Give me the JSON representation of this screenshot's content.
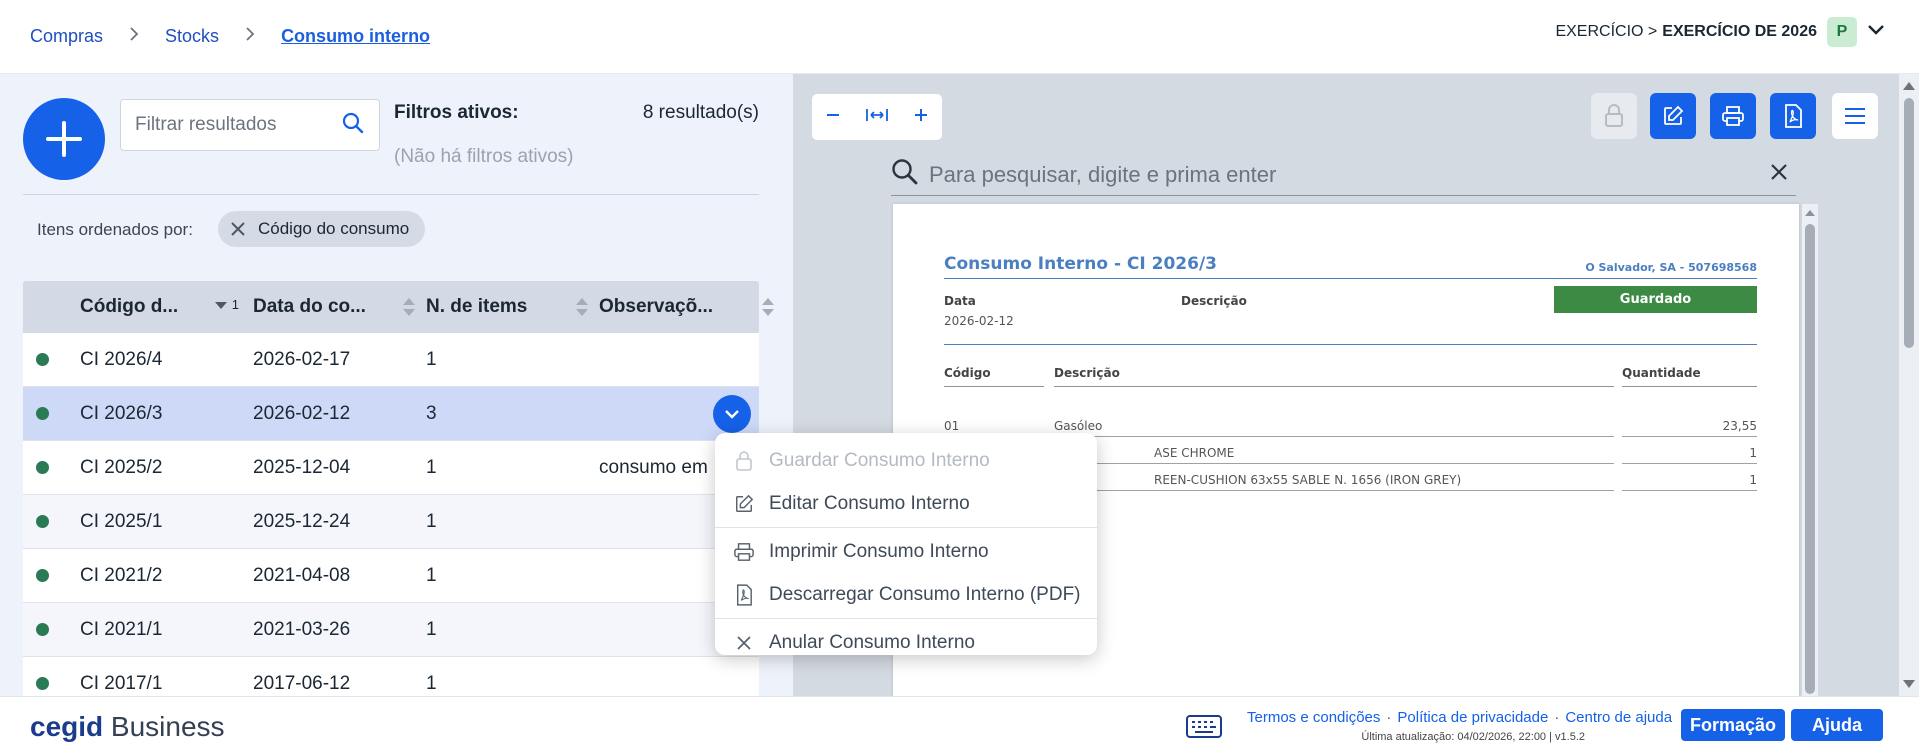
{
  "breadcrumb": [
    "Compras",
    "Stocks",
    "Consumo interno"
  ],
  "exercise": {
    "prefix": "EXERCÍCIO >",
    "value": "EXERCÍCIO DE 2026",
    "avatar": "P"
  },
  "list": {
    "search_placeholder": "Filtrar resultados",
    "filters_label": "Filtros ativos:",
    "filters_none": "(Não há filtros ativos)",
    "result_count": "8 resultado(s)",
    "sorted_by_label": "Itens ordenados por:",
    "sort_chip": "Código do consumo",
    "columns": [
      "Código d...",
      "Data do co...",
      "N. de items",
      "Observaçõ..."
    ],
    "sort_index": "1",
    "rows": [
      {
        "code": "CI 2026/4",
        "date": "2026-02-17",
        "items": "1",
        "obs": ""
      },
      {
        "code": "CI 2026/3",
        "date": "2026-02-12",
        "items": "3",
        "obs": ""
      },
      {
        "code": "CI 2025/2",
        "date": "2025-12-04",
        "items": "1",
        "obs": "consumo em"
      },
      {
        "code": "CI 2025/1",
        "date": "2025-12-24",
        "items": "1",
        "obs": ""
      },
      {
        "code": "CI 2021/2",
        "date": "2021-04-08",
        "items": "1",
        "obs": ""
      },
      {
        "code": "CI 2021/1",
        "date": "2021-03-26",
        "items": "1",
        "obs": ""
      },
      {
        "code": "CI 2017/1",
        "date": "2017-06-12",
        "items": "1",
        "obs": ""
      }
    ]
  },
  "context_menu": {
    "save": "Guardar Consumo Interno",
    "edit": "Editar Consumo Interno",
    "print": "Imprimir Consumo Interno",
    "download": "Descarregar Consumo Interno (PDF)",
    "cancel": "Anular Consumo Interno"
  },
  "viewer": {
    "search_placeholder": "Para pesquisar, digite e prima enter",
    "doc": {
      "title": "Consumo Interno - CI 2026/3",
      "company": "O Salvador, SA - 507698568",
      "status": "Guardado",
      "date_label": "Data",
      "date_value": "2026-02-12",
      "desc_label": "Descrição",
      "th_code": "Código",
      "th_desc": "Descrição",
      "th_qty": "Quantidade",
      "lines": [
        {
          "code": "01",
          "desc": "Gasóleo",
          "qty": "23,55"
        },
        {
          "code": "",
          "desc": "ASE CHROME",
          "qty": "1"
        },
        {
          "code": "",
          "desc": "REEN-CUSHION 63x55 SABLE N. 1656 (IRON GREY)",
          "qty": "1"
        }
      ]
    }
  },
  "footer": {
    "brand_a": "cegid",
    "brand_b": "Business",
    "link_terms": "Termos e condições",
    "link_privacy": "Política de privacidade",
    "link_help_center": "Centro de ajuda",
    "sep": "·",
    "updated": "Última atualização: 04/02/2026, 22:00 | v1.5.2",
    "btn_training": "Formação",
    "btn_help": "Ajuda"
  },
  "colors": {
    "primary": "#1561e8",
    "status_green": "#3d8a45",
    "row_selected": "#cdd9f7",
    "doc_blue": "#4a7fc1"
  }
}
